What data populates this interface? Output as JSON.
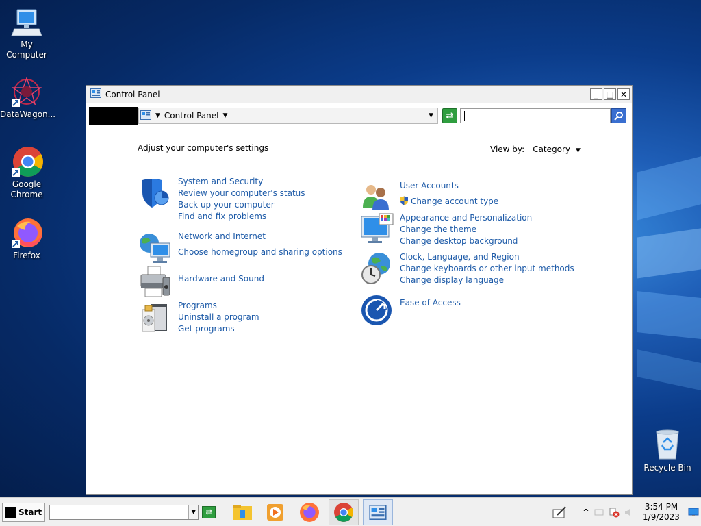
{
  "desktop": {
    "icons": [
      {
        "label": "My Computer"
      },
      {
        "label": "DataWagon..."
      },
      {
        "label": "Google Chrome"
      },
      {
        "label": "Firefox"
      },
      {
        "label": "Recycle Bin"
      }
    ]
  },
  "window": {
    "title": "Control Panel",
    "buttons": {
      "minimize": "_",
      "maximize": "□",
      "close": "✕"
    },
    "address": {
      "crumb": "Control Panel"
    },
    "search": {
      "value": ""
    }
  },
  "content": {
    "heading": "Adjust your computer's settings",
    "view_by_label": "View by:",
    "view_by_value": "Category",
    "categories_left": [
      {
        "icon": "shield-icon",
        "title": "System and Security",
        "links": [
          "Review your computer's status",
          "Back up your computer",
          "Find and fix problems"
        ]
      },
      {
        "icon": "network-icon",
        "title": "Network and Internet",
        "links": [
          "Choose homegroup and sharing options"
        ]
      },
      {
        "icon": "printer-icon",
        "title": "Hardware and Sound",
        "links": []
      },
      {
        "icon": "programs-icon",
        "title": "Programs",
        "links": [
          "Uninstall a program",
          "Get programs"
        ]
      }
    ],
    "categories_right": [
      {
        "icon": "users-icon",
        "title": "User Accounts",
        "links": [
          "Change account type"
        ]
      },
      {
        "icon": "monitor-icon",
        "title": "Appearance and Personalization",
        "links": [
          "Change the theme",
          "Change desktop background"
        ]
      },
      {
        "icon": "globe-clock-icon",
        "title": "Clock, Language, and Region",
        "links": [
          "Change keyboards or other input methods",
          "Change display language"
        ]
      },
      {
        "icon": "ease-of-access-icon",
        "title": "Ease of Access",
        "links": []
      }
    ]
  },
  "taskbar": {
    "start_label": "Start",
    "clock_time": "3:54 PM",
    "clock_date": "1/9/2023"
  },
  "colors": {
    "link": "#1e5ba8",
    "accent": "#2f9e3f"
  }
}
